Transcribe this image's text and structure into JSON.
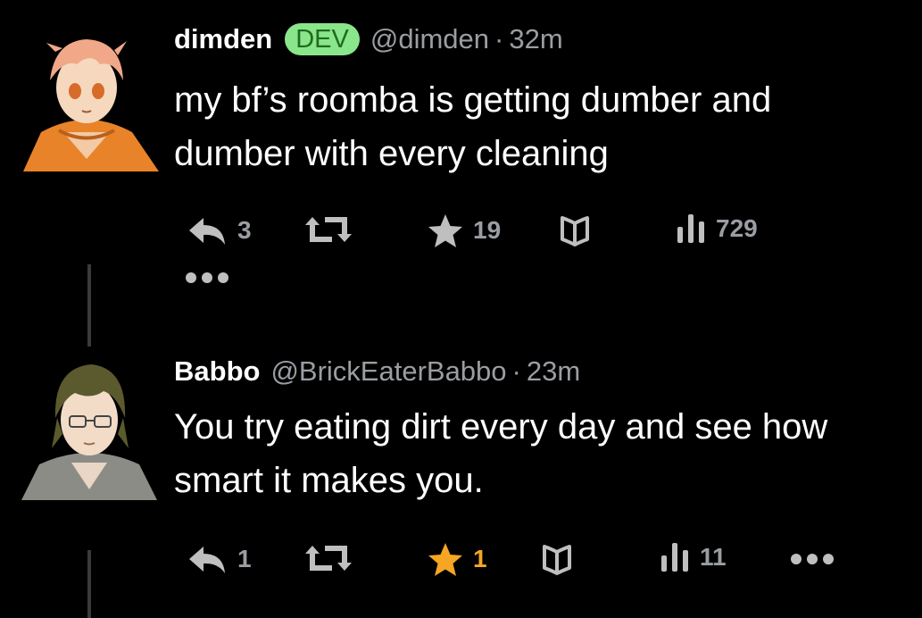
{
  "tweets": [
    {
      "author": {
        "name": "dimden",
        "badge": "DEV",
        "handle": "@dimden",
        "avatar": "anime-avatar-orange-hoodie"
      },
      "separator": "·",
      "time": "32m",
      "text": "my  bf’s  roomba is getting dumber and dumber with every cleaning",
      "actions": {
        "reply_count": "3",
        "retweet_count": "",
        "like_count": "19",
        "bookmark_count": "",
        "views_count": "729"
      },
      "liked": false
    },
    {
      "author": {
        "name": "Babbo",
        "handle": "@BrickEaterBabbo",
        "avatar": "anime-avatar-glasses"
      },
      "separator": "·",
      "time": "23m",
      "text": "You try eating dirt every day and see how smart it makes you.",
      "actions": {
        "reply_count": "1",
        "retweet_count": "",
        "like_count": "1",
        "bookmark_count": "",
        "views_count": "11"
      },
      "liked": true
    }
  ],
  "icons": {
    "reply": "reply-icon",
    "retweet": "retweet-icon",
    "like": "star-icon",
    "bookmark": "bookmark-icon",
    "views": "views-icon",
    "more": "more-icon"
  },
  "colors": {
    "background": "#000000",
    "secondary_text": "#9a9ea3",
    "dev_badge_bg": "#8ae68a",
    "dev_badge_text": "#1f6b1f",
    "like_active": "#f5a623"
  }
}
